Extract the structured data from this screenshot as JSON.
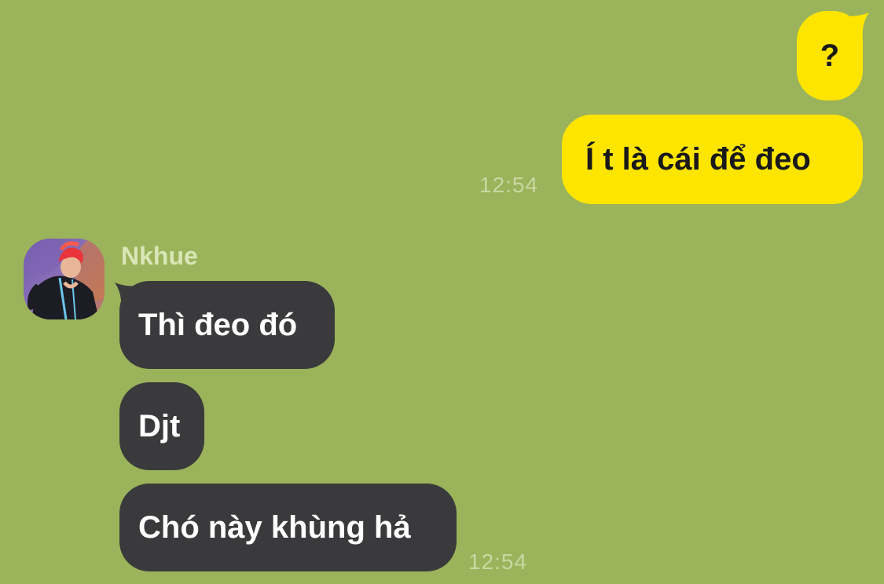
{
  "outgoing": {
    "messages": [
      {
        "text": "?"
      },
      {
        "text": "Í t là cái để đeo"
      }
    ],
    "time": "12:54"
  },
  "incoming": {
    "sender_name": "Nkhue",
    "avatar_icon": "profile-photo-icon",
    "messages": [
      {
        "text": "Thì đeo đó"
      },
      {
        "text": "Djt"
      },
      {
        "text": "Chó này khùng hả"
      }
    ],
    "time": "12:54"
  },
  "colors": {
    "background": "#9bb35a",
    "outgoing_bubble": "#fee500",
    "incoming_bubble": "#3a3a3c",
    "timestamp": "#c9d7a3"
  }
}
